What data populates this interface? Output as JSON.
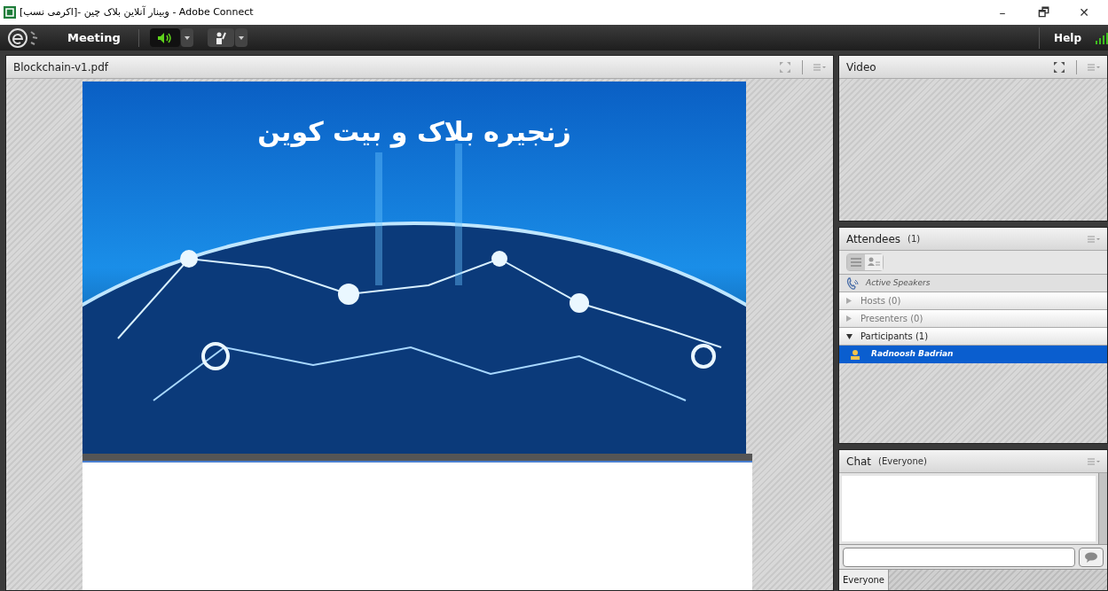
{
  "window": {
    "title": "Adobe Connect - وبینار آنلاین بلاک چین -[اکرمی نسب]",
    "controls": [
      "–",
      "🗗",
      "✕"
    ]
  },
  "menubar": {
    "items": [
      "Meeting"
    ],
    "speaker_on": true,
    "help": "Help"
  },
  "share_pod": {
    "title": "Blockchain-v1.pdf",
    "slide_title": "زنجیره بلاک و بیت کوین"
  },
  "video_pod": {
    "title": "Video"
  },
  "attendees_pod": {
    "title": "Attendees",
    "count": "(1)",
    "active_speakers": "Active Speakers",
    "groups": [
      {
        "label": "Hosts (0)",
        "expanded": false
      },
      {
        "label": "Presenters (0)",
        "expanded": false
      },
      {
        "label": "Participants (1)",
        "expanded": true,
        "children": [
          {
            "name": "Radnoosh Badrian",
            "selected": true
          }
        ]
      }
    ]
  },
  "chat_pod": {
    "title": "Chat",
    "scope": "(Everyone)",
    "tabs": [
      {
        "label": "Everyone",
        "selected": true
      }
    ]
  }
}
